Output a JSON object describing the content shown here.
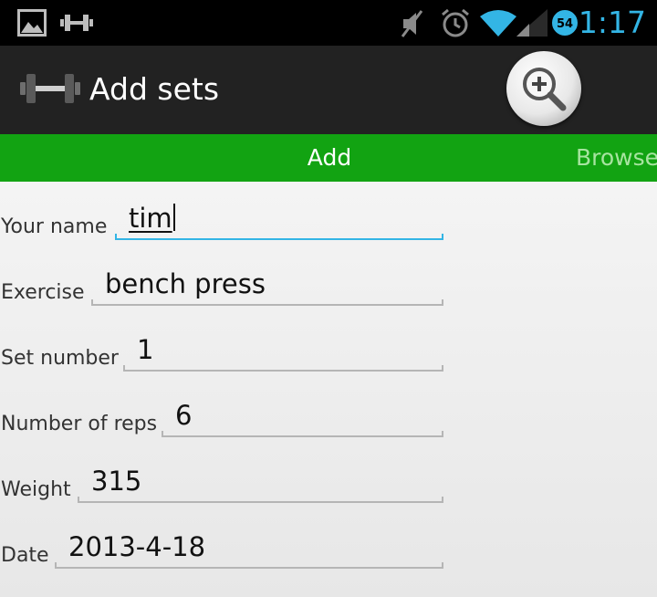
{
  "status_bar": {
    "time": "1:17",
    "battery_level": "54",
    "icons": [
      "image-icon",
      "dumbbell-icon",
      "mute-icon",
      "alarm-icon",
      "wifi-icon",
      "signal-icon",
      "battery-icon"
    ]
  },
  "action_bar": {
    "title": "Add sets",
    "app_icon": "dumbbell-icon",
    "search_icon": "zoom-in-icon"
  },
  "tabs": [
    {
      "label": "Add",
      "selected": true
    },
    {
      "label": "Browse",
      "selected": false
    }
  ],
  "form": {
    "fields": [
      {
        "label": "Your name",
        "value": "tim",
        "focused": true
      },
      {
        "label": "Exercise",
        "value": "bench press",
        "focused": false
      },
      {
        "label": "Set number",
        "value": "1",
        "focused": false
      },
      {
        "label": "Number of reps",
        "value": "6",
        "focused": false
      },
      {
        "label": "Weight",
        "value": "315",
        "focused": false
      },
      {
        "label": "Date",
        "value": "2013-4-18",
        "focused": false
      }
    ]
  },
  "colors": {
    "status_accent": "#33b5e5",
    "action_bar": "#222222",
    "tab_bar": "#12a312",
    "tab_inactive_text": "#a7e4a0",
    "focus_line": "#33b5e5"
  }
}
